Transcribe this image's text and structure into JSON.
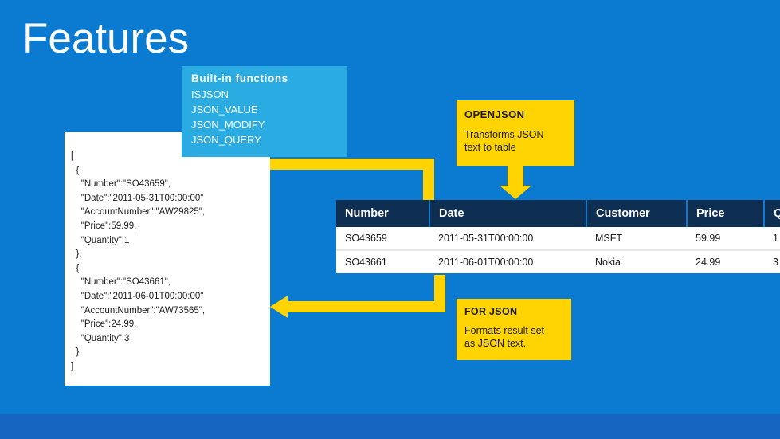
{
  "slide": {
    "title": "Features",
    "background_color": "#0a7bd1",
    "accent_color": "#ffd400"
  },
  "json_card": {
    "code": "[\n  {\n    \"Number\":\"SO43659\",\n    \"Date\":\"2011-05-31T00:00:00\"\n    \"AccountNumber\":\"AW29825\",\n    \"Price\":59.99,\n    \"Quantity\":1\n  },\n  {\n    \"Number\":\"SO43661\",\n    \"Date\":\"2011-06-01T00:00:00\"\n    \"AccountNumber\":\"AW73565\",\n    \"Price\":24.99,\n    \"Quantity\":3\n  }\n]"
  },
  "callout_builtin": {
    "heading": "Built-in functions",
    "lines": [
      "ISJSON",
      "JSON_VALUE",
      "JSON_MODIFY",
      "JSON_QUERY"
    ],
    "color": "#2aabe2"
  },
  "callout_openjson": {
    "heading": "OPENJSON",
    "body_line1": "Transforms JSON",
    "body_line2": "text to table",
    "color": "#ffd400"
  },
  "callout_forjson": {
    "heading": "FOR JSON",
    "body_line1": "Formats result set",
    "body_line2": "as JSON text.",
    "color": "#ffd400"
  },
  "result_table": {
    "columns": [
      "Number",
      "Date",
      "Customer",
      "Price",
      "Quantity"
    ],
    "rows": [
      {
        "number": "SO43659",
        "date": "2011-05-31T00:00:00",
        "customer": "MSFT",
        "price": "59.99",
        "quantity": "1"
      },
      {
        "number": "SO43661",
        "date": "2011-06-01T00:00:00",
        "customer": "Nokia",
        "price": "24.99",
        "quantity": "3"
      }
    ]
  }
}
